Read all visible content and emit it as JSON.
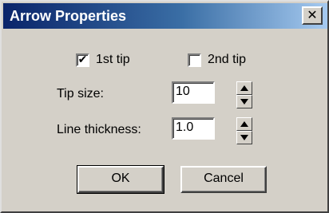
{
  "window": {
    "title": "Arrow Properties",
    "close_glyph": "✕"
  },
  "tips": {
    "first_tip": {
      "label": "1st tip",
      "checked": true,
      "glyph": "✔"
    },
    "second_tip": {
      "label": "2nd tip",
      "checked": false,
      "glyph": ""
    }
  },
  "fields": {
    "tip_size": {
      "label": "Tip size:",
      "value": "10"
    },
    "line_thickness": {
      "label": "Line thickness:",
      "value": "1.0"
    }
  },
  "buttons": {
    "ok_label": "OK",
    "cancel_label": "Cancel"
  },
  "colors": {
    "dialog_face": "#d4d0c8",
    "title_start": "#0a246a",
    "title_end": "#a6caf0"
  },
  "icons": [
    "close-icon",
    "check-icon",
    "up-arrow-icon",
    "down-arrow-icon"
  ]
}
